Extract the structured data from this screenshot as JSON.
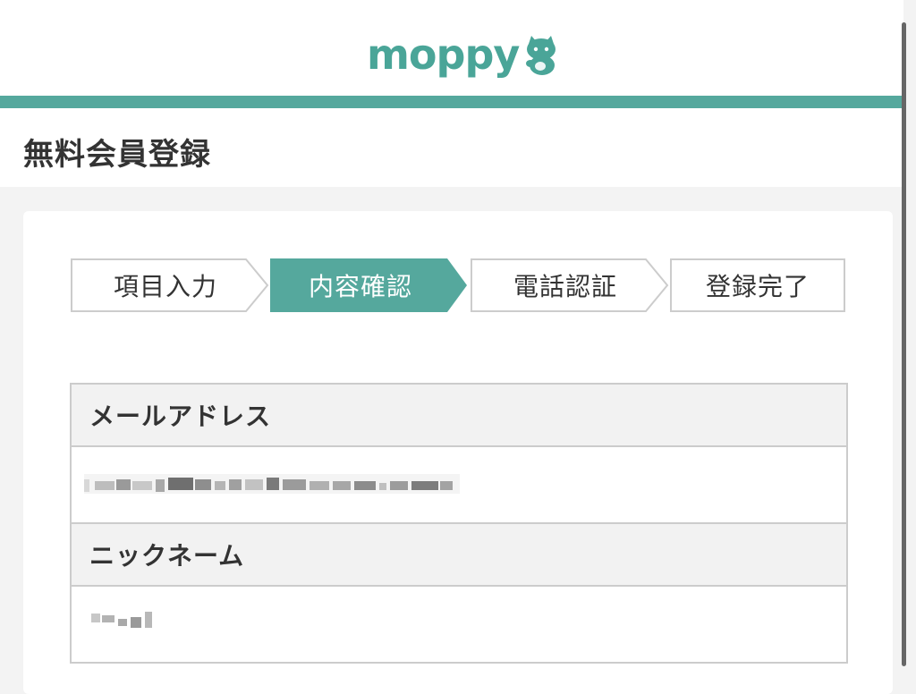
{
  "header": {
    "logo_text": "moppy",
    "brand_color": "#4aa598",
    "mascot_icon": "cat-mascot-icon"
  },
  "page": {
    "title": "無料会員登録"
  },
  "steps": [
    {
      "label": "項目入力",
      "active": false
    },
    {
      "label": "内容確認",
      "active": true
    },
    {
      "label": "電話認証",
      "active": false
    },
    {
      "label": "登録完了",
      "active": false
    }
  ],
  "colors": {
    "accent": "#55a89d",
    "border": "#cccccc",
    "row_head_bg": "#f2f2f2"
  },
  "fields": [
    {
      "label": "メールアドレス",
      "value_state": "obscured"
    },
    {
      "label": "ニックネーム",
      "value_state": "obscured"
    }
  ]
}
